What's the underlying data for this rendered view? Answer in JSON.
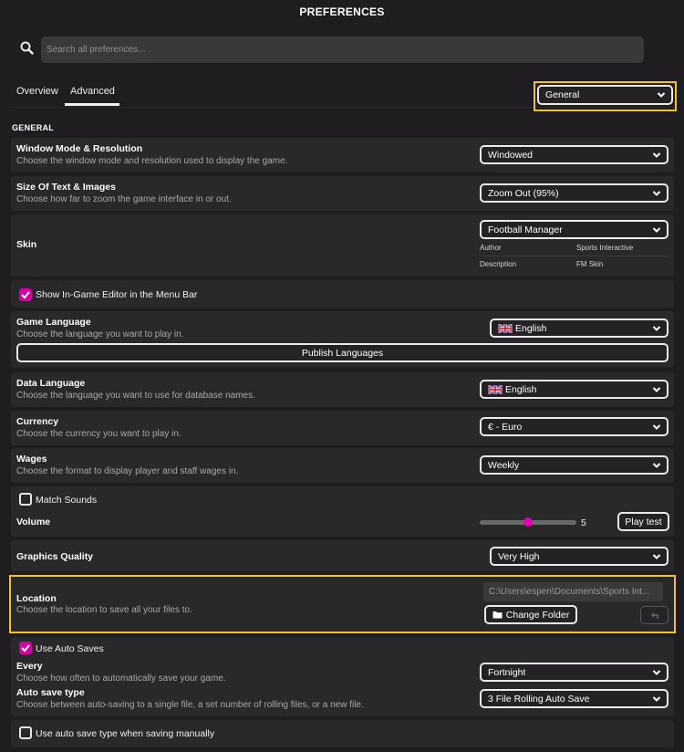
{
  "window": {
    "title": "PREFERENCES"
  },
  "search": {
    "placeholder": "Search all preferences..."
  },
  "tabs": [
    {
      "label": "Overview",
      "active": false
    },
    {
      "label": "Advanced",
      "active": true
    }
  ],
  "category_select": {
    "value": "General"
  },
  "section": {
    "heading": "GENERAL"
  },
  "window_mode": {
    "title": "Window Mode & Resolution",
    "desc": "Choose the window mode and resolution used to display the game.",
    "value": "Windowed"
  },
  "text_size": {
    "title": "Size Of Text & Images",
    "desc": "Choose how far to zoom the game interface in or out.",
    "value": "Zoom Out (95%)"
  },
  "skin": {
    "title": "Skin",
    "value": "Football Manager",
    "author_label": "Author",
    "author_value": "Sports Interactive",
    "description_label": "Description",
    "description_value": "FM Skin"
  },
  "in_game_editor": {
    "label": "Show In-Game Editor in the Menu Bar",
    "checked": true
  },
  "game_language": {
    "title": "Game Language",
    "desc": "Choose the language you want to play in.",
    "value": "English",
    "publish_label": "Publish Languages"
  },
  "data_language": {
    "title": "Data Language",
    "desc": "Choose the language you want to use for database names.",
    "value": "English"
  },
  "currency": {
    "title": "Currency",
    "desc": "Choose the currency you want to play in.",
    "value": "€ - Euro"
  },
  "wages": {
    "title": "Wages",
    "desc": "Choose the format to display player and staff wages in.",
    "value": "Weekly"
  },
  "match_sounds": {
    "label": "Match Sounds",
    "checked": false
  },
  "volume": {
    "title": "Volume",
    "value": "5",
    "level_fraction": 0.5,
    "play_test_label": "Play test"
  },
  "graphics": {
    "title": "Graphics Quality",
    "value": "Very High"
  },
  "location": {
    "title": "Location",
    "desc": "Choose the location to save all your files to.",
    "path": "C:\\Users\\espen\\Documents\\Sports Int...",
    "change_folder_label": "Change Folder"
  },
  "auto_saves": {
    "label": "Use Auto Saves",
    "checked": true
  },
  "every": {
    "title": "Every",
    "desc": "Choose how often to automatically save your game.",
    "value": "Fortnight"
  },
  "auto_save_type": {
    "title": "Auto save type",
    "desc": "Choose between auto-saving to a single file, a set number of rolling files, or a new file.",
    "value": "3 File Rolling Auto Save"
  },
  "manual_auto_save": {
    "label": "Use auto save type when saving manually",
    "checked": false
  },
  "colors": {
    "background": "#1f1d1f",
    "row": "#2a292a",
    "accent_magenta": "#d400a6",
    "highlight_yellow": "#f1c22e"
  },
  "icons": {
    "search": "search-icon",
    "chevron": "chevron-down-icon",
    "flag": "uk-flag-icon",
    "folder": "folder-icon",
    "reset": "undo-icon",
    "check": "checkmark-icon"
  }
}
